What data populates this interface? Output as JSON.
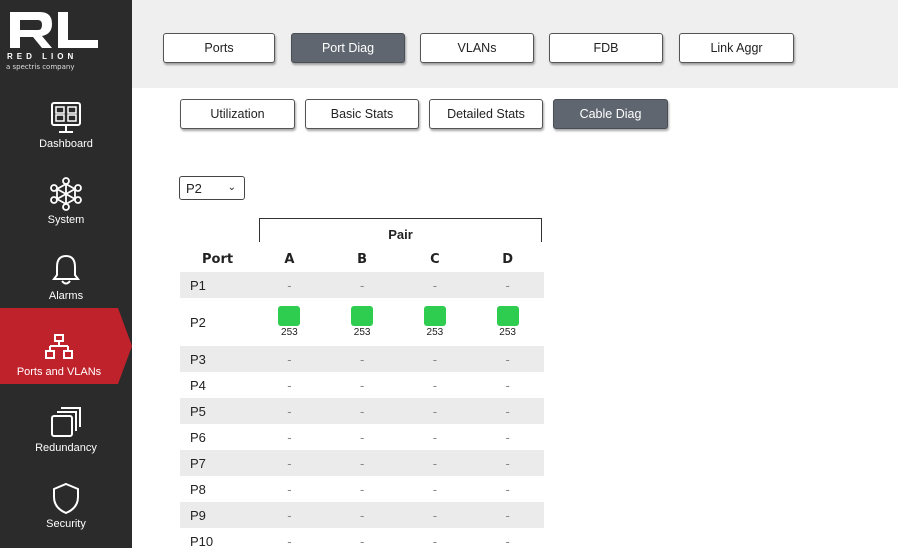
{
  "brand": {
    "name": "RED LION",
    "tagline": "a spectris company"
  },
  "sidebar": {
    "items": [
      {
        "label": "Dashboard",
        "icon": "dashboard-icon",
        "active": false
      },
      {
        "label": "System",
        "icon": "system-network-icon",
        "active": false
      },
      {
        "label": "Alarms",
        "icon": "bell-icon",
        "active": false
      },
      {
        "label": "Ports and VLANs",
        "icon": "network-topology-icon",
        "active": true
      },
      {
        "label": "Redundancy",
        "icon": "stacked-windows-icon",
        "active": false
      },
      {
        "label": "Security",
        "icon": "shield-icon",
        "active": false
      }
    ]
  },
  "top_tabs": [
    "Ports",
    "Port Diag",
    "VLANs",
    "FDB",
    "Link Aggr"
  ],
  "top_tab_selected": "Port Diag",
  "sub_tabs": [
    "Utilization",
    "Basic Stats",
    "Detailed Stats",
    "Cable Diag"
  ],
  "sub_tab_selected": "Cable Diag",
  "port_select": {
    "value": "P2"
  },
  "table": {
    "group_header": "Pair",
    "port_header": "Port",
    "pair_headers": [
      "A",
      "B",
      "C",
      "D"
    ],
    "rows": [
      {
        "port": "P1",
        "A": "-",
        "B": "-",
        "C": "-",
        "D": "-"
      },
      {
        "port": "P2",
        "A": "253",
        "B": "253",
        "C": "253",
        "D": "253",
        "status": "ok"
      },
      {
        "port": "P3",
        "A": "-",
        "B": "-",
        "C": "-",
        "D": "-"
      },
      {
        "port": "P4",
        "A": "-",
        "B": "-",
        "C": "-",
        "D": "-"
      },
      {
        "port": "P5",
        "A": "-",
        "B": "-",
        "C": "-",
        "D": "-"
      },
      {
        "port": "P6",
        "A": "-",
        "B": "-",
        "C": "-",
        "D": "-"
      },
      {
        "port": "P7",
        "A": "-",
        "B": "-",
        "C": "-",
        "D": "-"
      },
      {
        "port": "P8",
        "A": "-",
        "B": "-",
        "C": "-",
        "D": "-"
      },
      {
        "port": "P9",
        "A": "-",
        "B": "-",
        "C": "-",
        "D": "-"
      },
      {
        "port": "P10",
        "A": "-",
        "B": "-",
        "C": "-",
        "D": "-"
      }
    ]
  },
  "colors": {
    "sidebar_bg": "#2b2b2b",
    "active_red": "#c0222c",
    "selected_tab": "#5f6670",
    "status_ok": "#2ecc4f",
    "row_stripe": "#ebebeb"
  }
}
